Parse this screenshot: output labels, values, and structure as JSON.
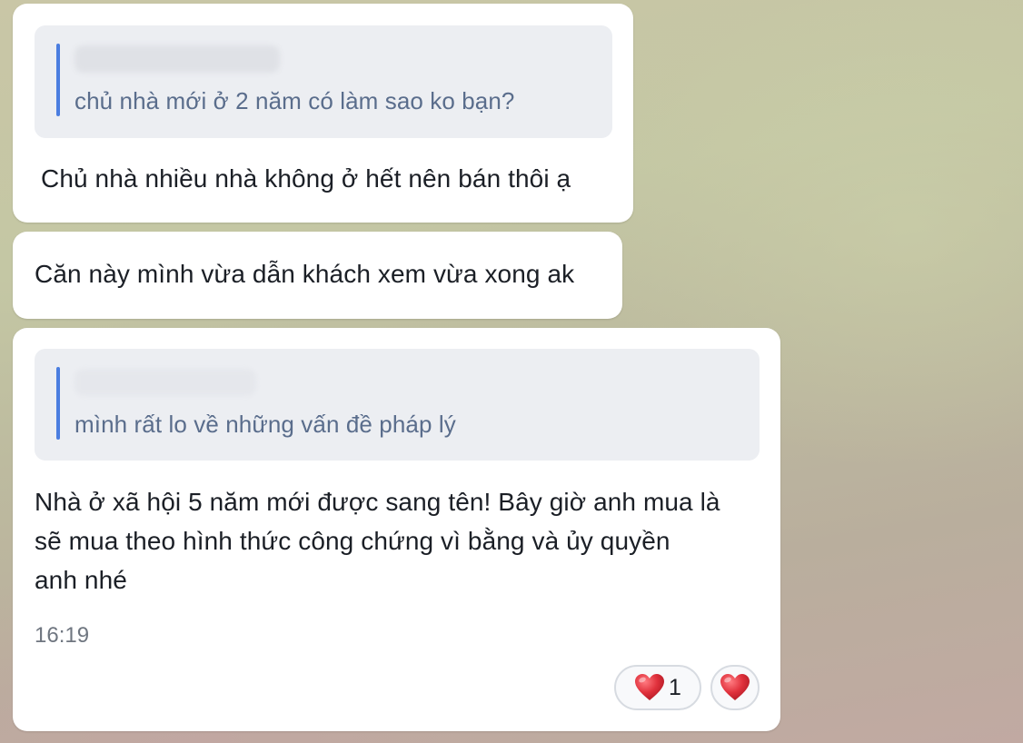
{
  "messages": [
    {
      "quote": {
        "text": "chủ nhà mới ở 2 năm có làm sao ko bạn?"
      },
      "text": "Chủ nhà nhiều nhà không ở hết nên bán thôi ạ"
    },
    {
      "text": "Căn này mình vừa dẫn khách xem vừa xong ak"
    },
    {
      "quote": {
        "text": "mình rất lo về những vấn đề pháp lý"
      },
      "lines": [
        "Nhà ở xã hội 5 năm mới được sang tên! Bây giờ anh mua là",
        "sẽ mua theo hình thức công chứng vì bằng và ủy quyền",
        "anh nhé"
      ],
      "time": "16:19",
      "reactions": [
        {
          "icon": "heart-icon",
          "count": "1"
        },
        {
          "icon": "heart-icon"
        }
      ]
    }
  ],
  "colors": {
    "quote_bar": "#4a7de0",
    "quote_text": "#5a6d8c",
    "heart": "#e0313c"
  }
}
